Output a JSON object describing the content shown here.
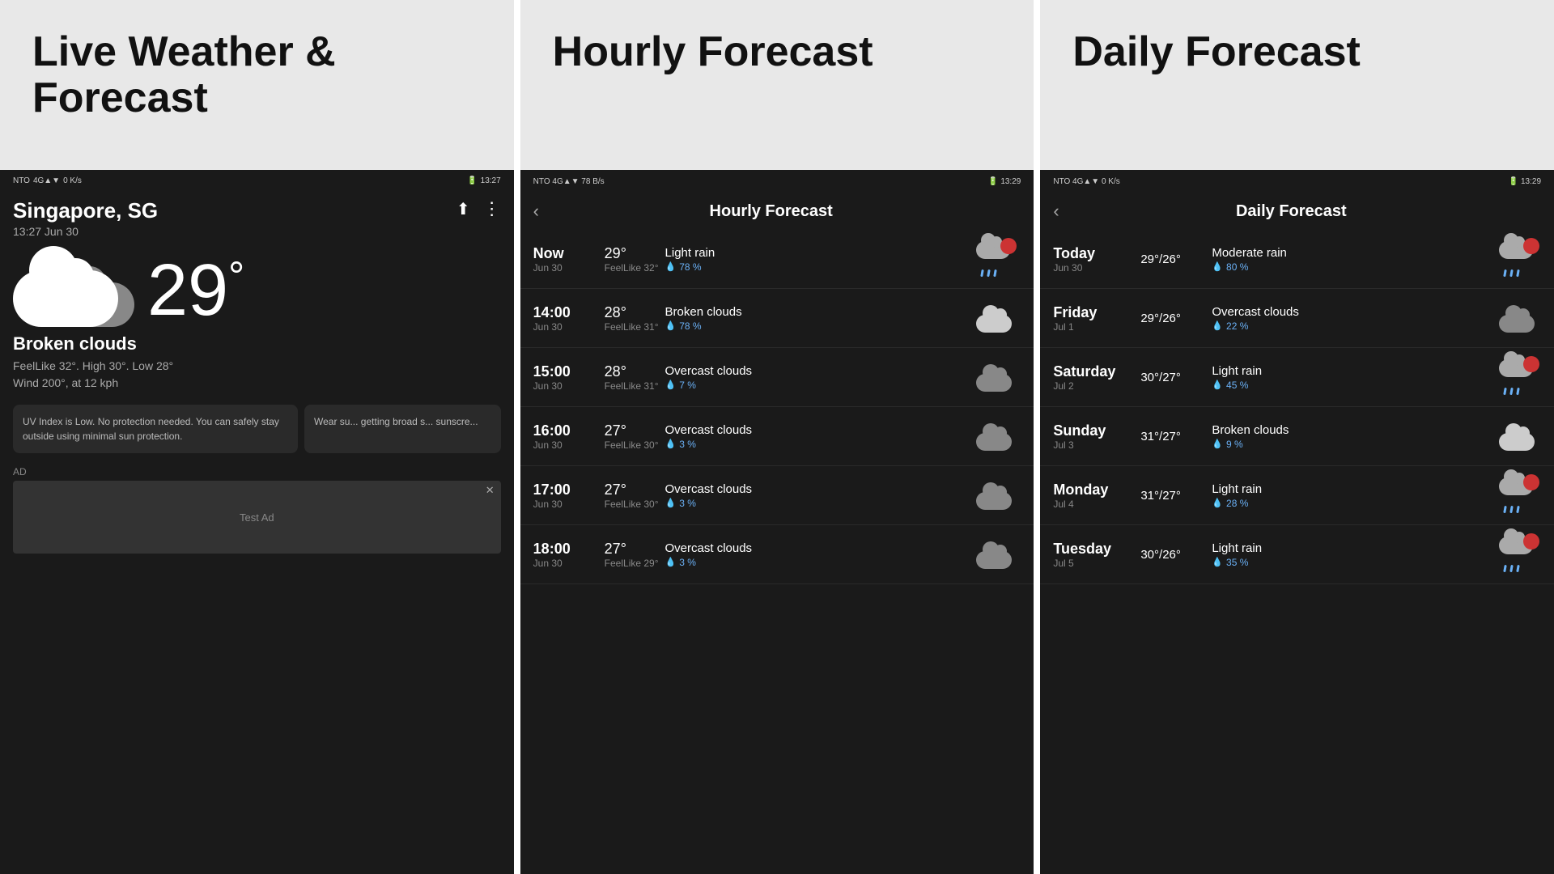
{
  "panels": {
    "left": {
      "title": "Live Weather &\nForecast",
      "status_bar": {
        "left": "NTO 4G↑↓ 0 K/s",
        "right": "13:27"
      },
      "location": "Singapore, SG",
      "datetime": "13:27 Jun 30",
      "temperature": "29",
      "condition": "Broken clouds",
      "feels_like": "FeelLike 32°. High 30°. Low 28°",
      "wind": "Wind 200°, at 12 kph",
      "uv_info": "UV Index is Low. No protection needed. You can safely stay outside using minimal sun protection.",
      "wear_info": "Wear su... getting broad s... sunscre...",
      "ad_label": "AD",
      "ad_text": "Test Ad"
    },
    "middle": {
      "title": "Hourly Forecast",
      "screen_title": "Hourly Forecast",
      "status_bar": {
        "left": "NTO 4G↑↓ 78 B/s",
        "right": "13:29"
      },
      "items": [
        {
          "time": "Now",
          "date": "Jun 30",
          "temp": "29°",
          "feels_like": "FeelLike 32°",
          "condition": "Light rain",
          "rain_pct": "78 %",
          "icon_type": "rain-sun"
        },
        {
          "time": "14:00",
          "date": "Jun 30",
          "temp": "28°",
          "feels_like": "FeelLike 31°",
          "condition": "Broken clouds",
          "rain_pct": "78 %",
          "icon_type": "cloud-light"
        },
        {
          "time": "15:00",
          "date": "Jun 30",
          "temp": "28°",
          "feels_like": "FeelLike 31°",
          "condition": "Overcast clouds",
          "rain_pct": "7 %",
          "icon_type": "cloud-dark"
        },
        {
          "time": "16:00",
          "date": "Jun 30",
          "temp": "27°",
          "feels_like": "FeelLike 30°",
          "condition": "Overcast clouds",
          "rain_pct": "3 %",
          "icon_type": "cloud-dark"
        },
        {
          "time": "17:00",
          "date": "Jun 30",
          "temp": "27°",
          "feels_like": "FeelLike 30°",
          "condition": "Overcast clouds",
          "rain_pct": "3 %",
          "icon_type": "cloud-dark"
        },
        {
          "time": "18:00",
          "date": "Jun 30",
          "temp": "27°",
          "feels_like": "FeelLike 29°",
          "condition": "Overcast clouds",
          "rain_pct": "3 %",
          "icon_type": "cloud-dark"
        }
      ]
    },
    "right": {
      "title": "Daily Forecast",
      "screen_title": "Daily Forecast",
      "status_bar": {
        "left": "NTO 4G↑↓ 0 K/s",
        "right": "13:29"
      },
      "items": [
        {
          "day": "Today",
          "date": "Jun 30",
          "temp": "29°/26°",
          "condition": "Moderate rain",
          "rain_pct": "80 %",
          "icon_type": "rain-sun"
        },
        {
          "day": "Friday",
          "date": "Jul 1",
          "temp": "29°/26°",
          "condition": "Overcast clouds",
          "rain_pct": "22 %",
          "icon_type": "cloud-dark"
        },
        {
          "day": "Saturday",
          "date": "Jul 2",
          "temp": "30°/27°",
          "condition": "Light rain",
          "rain_pct": "45 %",
          "icon_type": "rain-sun"
        },
        {
          "day": "Sunday",
          "date": "Jul 3",
          "temp": "31°/27°",
          "condition": "Broken clouds",
          "rain_pct": "9 %",
          "icon_type": "cloud-light"
        },
        {
          "day": "Monday",
          "date": "Jul 4",
          "temp": "31°/27°",
          "condition": "Light rain",
          "rain_pct": "28 %",
          "icon_type": "rain-sun"
        },
        {
          "day": "Tuesday",
          "date": "Jul 5",
          "temp": "30°/26°",
          "condition": "Light rain",
          "rain_pct": "35 %",
          "icon_type": "rain-sun"
        }
      ]
    }
  }
}
